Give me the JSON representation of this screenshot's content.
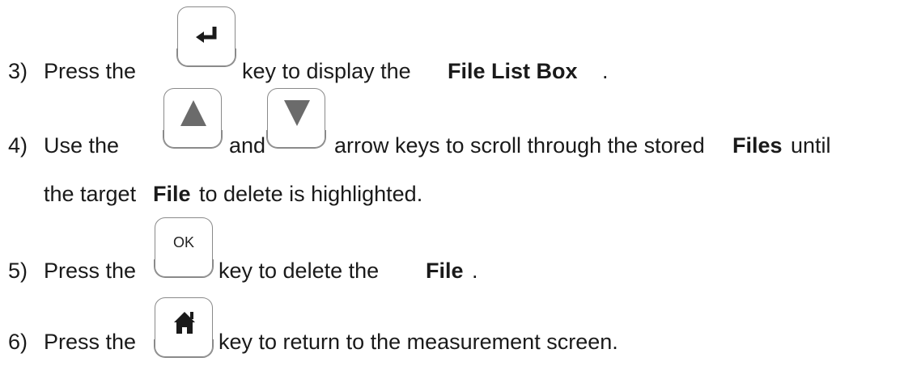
{
  "steps": [
    {
      "number": "3)",
      "pre": "Press the",
      "post": "key to display the",
      "bold": "File List Box",
      "end": "."
    },
    {
      "number": "4)",
      "pre": "Use the",
      "mid": "and",
      "post": "arrow keys to scroll through the stored",
      "bold": "Files",
      "end": "until",
      "cont_pre": "the target",
      "cont_bold": "File",
      "cont_end": "to delete is highlighted."
    },
    {
      "number": "5)",
      "pre": "Press the",
      "key_label": "OK",
      "post": "key to delete the",
      "bold": "File",
      "end": "."
    },
    {
      "number": "6)",
      "pre": "Press the",
      "post": "key to return to the measurement screen."
    }
  ],
  "icons": {
    "enter": "enter-return-icon",
    "up": "up-arrow-icon",
    "down": "down-arrow-icon",
    "ok": "ok-key-icon",
    "home": "home-icon"
  },
  "colors": {
    "key_border": "#8a8a8a",
    "glyph_dark": "#1a1a1a",
    "glyph_gray": "#6b6b6b"
  }
}
